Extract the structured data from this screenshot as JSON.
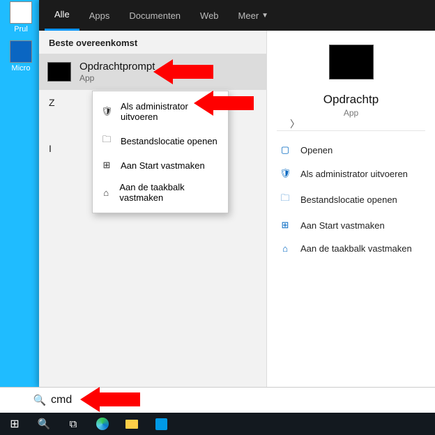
{
  "desktop_icons": {
    "a": "Prul",
    "b": "Micro"
  },
  "tabs": {
    "all": "Alle",
    "apps": "Apps",
    "docs": "Documenten",
    "web": "Web",
    "more": "Meer"
  },
  "section_best": "Beste overeenkomst",
  "best_match": {
    "title": "Opdrachtprompt",
    "subtitle": "App"
  },
  "hidden1": "Z",
  "hidden2": "I",
  "context_menu": {
    "admin": "Als administrator uitvoeren",
    "openloc": "Bestandslocatie openen",
    "pin_start": "Aan Start vastmaken",
    "pin_taskbar": "Aan de taakbalk vastmaken"
  },
  "detail": {
    "title": "Opdrachtp",
    "subtitle": "App"
  },
  "detail_actions": {
    "open": "Openen",
    "admin": "Als administrator uitvoeren",
    "openloc": "Bestandslocatie openen",
    "pin_start": "Aan Start vastmaken",
    "pin_taskbar": "Aan de taakbalk vastmaken"
  },
  "search_value": "cmd"
}
